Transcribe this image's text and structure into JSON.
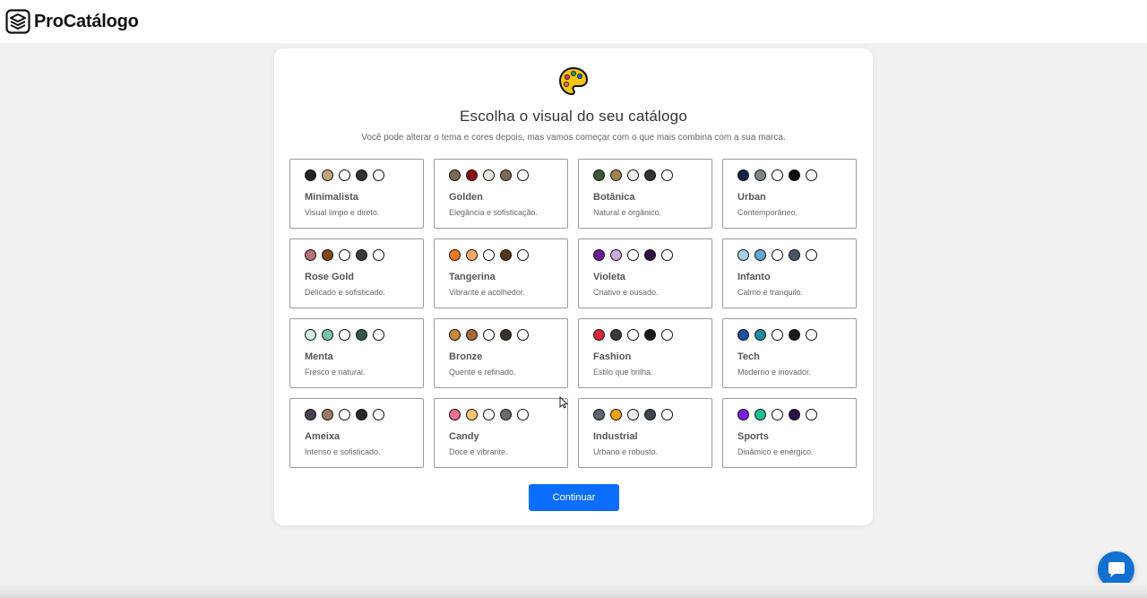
{
  "app": {
    "name": "ProCatálogo"
  },
  "header": {
    "title": "Escolha o visual do seu catálogo",
    "subtitle": "Você pode alterar o tema e cores depois, mas vamos começar com o que mais combina com a sua marca."
  },
  "themes": [
    {
      "name": "Minimalista",
      "desc": "Visual limpo e direto.",
      "colors": [
        "#222222",
        "#c6a47a",
        "#ffffff",
        "#333333",
        "#ffffff"
      ]
    },
    {
      "name": "Golden",
      "desc": "Elegância e sofisticação.",
      "colors": [
        "#7a6a52",
        "#8b0d12",
        "#e9e4da",
        "#7d6a55",
        "#ffffff"
      ]
    },
    {
      "name": "Botânica",
      "desc": "Natural e orgânico.",
      "colors": [
        "#3d5a33",
        "#a08350",
        "#efefea",
        "#333333",
        "#ffffff"
      ]
    },
    {
      "name": "Urban",
      "desc": "Contemporâneo.",
      "colors": [
        "#15224a",
        "#808589",
        "#ffffff",
        "#0b0b0b",
        "#ffffff"
      ]
    },
    {
      "name": "Rose Gold",
      "desc": "Delicado e sofisticado.",
      "colors": [
        "#b5727a",
        "#7d4a1d",
        "#ffffff",
        "#3a3a3a",
        "#ffffff"
      ]
    },
    {
      "name": "Tangerina",
      "desc": "Vibrante e acolhedor.",
      "colors": [
        "#f07a22",
        "#f5a96a",
        "#ffffff",
        "#5a3716",
        "#ffffff"
      ]
    },
    {
      "name": "Violeta",
      "desc": "Criativo e ousado.",
      "colors": [
        "#6a1b9a",
        "#cfa7dd",
        "#ffffff",
        "#33104a",
        "#ffffff"
      ]
    },
    {
      "name": "Infanto",
      "desc": "Calmo e tranquilo.",
      "colors": [
        "#a6d0ee",
        "#62a8d4",
        "#ffffff",
        "#46576a",
        "#ffffff"
      ]
    },
    {
      "name": "Menta",
      "desc": "Fresco e natural.",
      "colors": [
        "#cdebe0",
        "#78c4aa",
        "#ffffff",
        "#33574a",
        "#ffffff"
      ]
    },
    {
      "name": "Bronze",
      "desc": "Quente e refinado.",
      "colors": [
        "#c88a40",
        "#a9673a",
        "#ffffff",
        "#3a3127",
        "#ffffff"
      ]
    },
    {
      "name": "Fashion",
      "desc": "Estilo que brilha.",
      "colors": [
        "#d9263a",
        "#3a3a3a",
        "#ffffff",
        "#1a1a1a",
        "#ffffff"
      ]
    },
    {
      "name": "Tech",
      "desc": "Moderno e inovador.",
      "colors": [
        "#1e4fa0",
        "#1f8aa2",
        "#ffffff",
        "#1b1b1b",
        "#ffffff"
      ]
    },
    {
      "name": "Ameixa",
      "desc": "Intenso e sofisticado.",
      "colors": [
        "#4a3f52",
        "#9e7a62",
        "#ffffff",
        "#2a2a2a",
        "#ffffff"
      ]
    },
    {
      "name": "Candy",
      "desc": "Doce e vibrante.",
      "colors": [
        "#ef6f8e",
        "#f7c76f",
        "#ffffff",
        "#6b6b6b",
        "#ffffff"
      ]
    },
    {
      "name": "Industrial",
      "desc": "Urbano e robusto.",
      "colors": [
        "#5d6670",
        "#f0a21b",
        "#ebebeb",
        "#3b4650",
        "#ffffff"
      ]
    },
    {
      "name": "Sports",
      "desc": "Dinâmico e enérgico.",
      "colors": [
        "#7a1fe0",
        "#1fbf98",
        "#ffffff",
        "#2a0f4a",
        "#ffffff"
      ]
    }
  ],
  "actions": {
    "continue_label": "Continuar"
  },
  "icons": {
    "brand": "stack-layers-icon",
    "header": "palette-icon",
    "chat": "chat-bubble-icon"
  }
}
